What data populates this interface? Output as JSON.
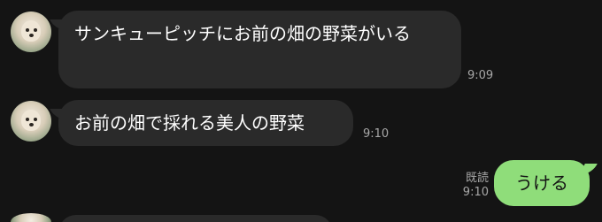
{
  "messages": [
    {
      "text": "サンキューピッチにお前の畑の野菜がいる",
      "time": "9:09",
      "direction": "incoming",
      "sender_icon": "dog-avatar-icon"
    },
    {
      "text": "お前の畑で採れる美人の野菜",
      "time": "9:10",
      "direction": "incoming",
      "sender_icon": "dog-avatar-icon"
    },
    {
      "text": "うける",
      "time": "9:10",
      "read_label": "既読",
      "direction": "outgoing"
    }
  ],
  "colors": {
    "background": "#141414",
    "incoming_bubble": "#2a2a2a",
    "outgoing_bubble": "#8fdd7a",
    "meta_text": "#a7a7a7"
  }
}
